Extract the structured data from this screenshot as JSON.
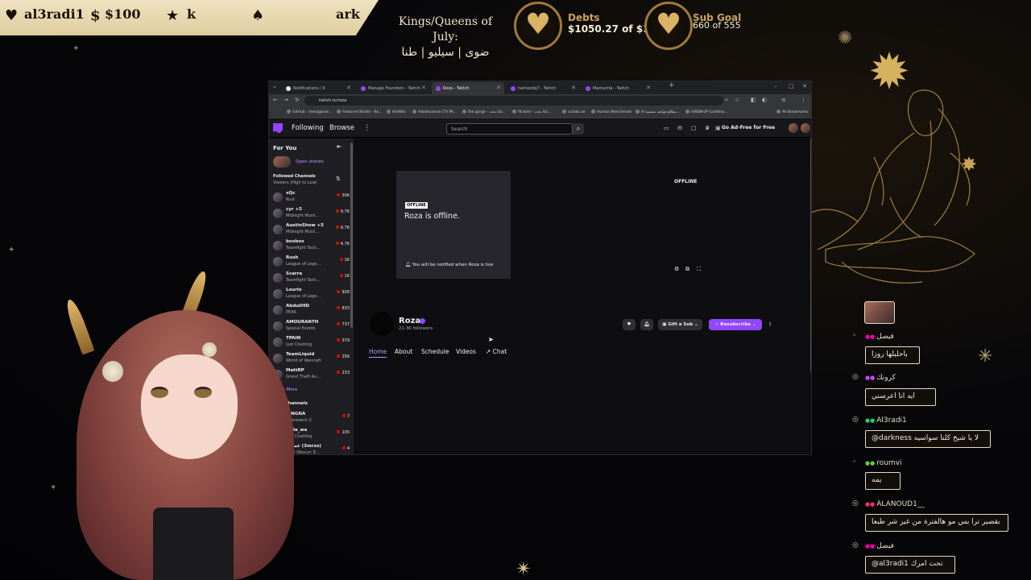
{
  "banner": {
    "handle": "al3radi1",
    "amount": "$100",
    "star_value": "k",
    "suffix": "ark",
    "icons": [
      "heart-icon",
      "dollar-icon",
      "star-icon",
      "spade-icon"
    ]
  },
  "kings": {
    "title": "Kings/Queens of July:",
    "names": "ضوى | سيليو | طنا"
  },
  "debts": {
    "title": "Debts",
    "value": "$1050.27 of $1111"
  },
  "subgoal": {
    "title": "Sub Goal",
    "value": "660 of 555"
  },
  "browser": {
    "tabs": [
      "Notifications / X",
      "Manage Founders - Twitch",
      "Roza - Twitch",
      "hamoodq7 - Twitch",
      "Mamacita - Twitch"
    ],
    "active_tab_index": 2,
    "url": "twitch.tv/roza",
    "bookmarks": [
      "GitHub - mesogiane...",
      "Featured Builds - Re...",
      "theWiki",
      "Adolescence (TV Mi...",
      "the gorge - بحث Go...",
      "fit born - بحث Go...",
      "cctabs.ae",
      "Human Benchmark",
      "مطالع هواتف منتشية الا...",
      "HWDN-JP Cordless..."
    ],
    "all_bookmarks": "All Bookmarks"
  },
  "twitch": {
    "nav_following": "Following",
    "nav_browse": "Browse",
    "search_placeholder": "Search",
    "adfree": "Go Ad-Free for Free",
    "sidebar": {
      "for_you": "For You",
      "open_stories": "Open stories",
      "followed_header": "Followed Channels",
      "sort_label": "Viewers (High to Low)",
      "followed": [
        {
          "name": "xQc",
          "game": "Rust",
          "viewers": "30K"
        },
        {
          "name": "cyr +5",
          "game": "Midnight Murd...",
          "viewers": "9.7K"
        },
        {
          "name": "AustinShow +5",
          "game": "Midnight Murd...",
          "viewers": "9.7K"
        },
        {
          "name": "boxbox",
          "game": "Teamfight Tacti...",
          "viewers": "4.7K"
        },
        {
          "name": "Rush",
          "game": "League of Lege...",
          "viewers": "1K"
        },
        {
          "name": "Scarra",
          "game": "Teamfight Tacti...",
          "viewers": "1K"
        },
        {
          "name": "Lourlo",
          "game": "League of Lege...",
          "viewers": "926"
        },
        {
          "name": "AbdullHD",
          "game": "PEAK",
          "viewers": "833"
        },
        {
          "name": "AMOURANTH",
          "game": "Special Events",
          "viewers": "737"
        },
        {
          "name": "TPAIN",
          "game": "Just Chatting",
          "viewers": "379"
        },
        {
          "name": "TeamLiquid",
          "game": "World of Warcraft",
          "viewers": "256"
        },
        {
          "name": "MattRP",
          "game": "Grand Theft Au...",
          "viewers": "233"
        }
      ],
      "show_more": "Show More",
      "live_header": "Live Channels",
      "live": [
        {
          "name": "IANGNA",
          "game": "Overwatch 2",
          "viewers": "7"
        },
        {
          "name": "layla_wa",
          "game": "Just Chatting",
          "viewers": "105"
        },
        {
          "name": "غمغمر (3mrzo)",
          "game": "Clair Obscur: E...",
          "viewers": "4"
        }
      ]
    },
    "offline_badge": "OFFLINE",
    "offline_title": "Roza is offline.",
    "offline_notify": "You will be notified when Roza is live",
    "player_offline": "OFFLINE",
    "channel_name": "Roza",
    "followers": "21.3K followers",
    "gift_sub": "Gift a Sub",
    "resubscribe": "Resubscribe",
    "tabs": [
      "Home",
      "About",
      "Schedule",
      "Videos",
      "Chat"
    ]
  },
  "chat": [
    {
      "user": "فيصل",
      "message": "باحليلها روزا"
    },
    {
      "user": "كرونك",
      "message": "ايه انا اعرسني"
    },
    {
      "user": "Al3radi1",
      "message": "@darkness لا يا شيخ كلنا سواسيه"
    },
    {
      "user": "roumvi",
      "message": "يمه"
    },
    {
      "user": "ALANOUD1__",
      "message": "بقصير ترا بس مو هالفترة من غير شر طبعا"
    },
    {
      "user": "فيصل",
      "message": "@al3radi1 تحت امرك"
    }
  ],
  "colors": {
    "gold": "#d6b25e",
    "twitch_purple": "#9146ff",
    "banner_bg": "#efe2c0"
  }
}
